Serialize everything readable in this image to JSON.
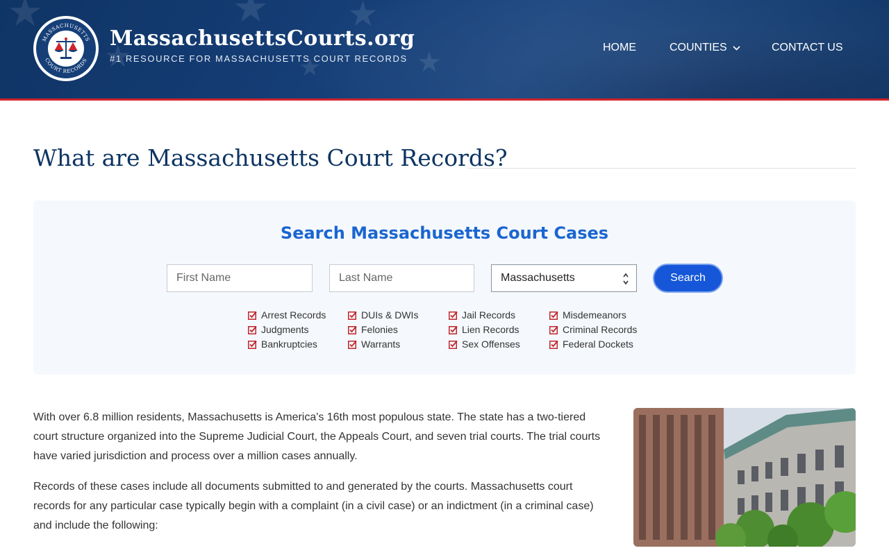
{
  "header": {
    "brand_title": "MassachusettsCourts.org",
    "brand_tagline": "#1 RESOURCE FOR MASSACHUSETTS COURT RECORDS",
    "seal_top_text": "MASSACHUSETTS",
    "seal_bottom_text": "COURT RECORDS",
    "nav": {
      "home": "HOME",
      "counties": "COUNTIES",
      "contact": "CONTACT US"
    }
  },
  "page_title": "What are Massachusetts Court Records?",
  "search": {
    "title": "Search Massachusetts Court Cases",
    "first_name_placeholder": "First Name",
    "last_name_placeholder": "Last Name",
    "state_selected": "Massachusetts",
    "button_label": "Search",
    "record_types": [
      "Arrest Records",
      "Judgments",
      "Bankruptcies",
      "DUIs & DWIs",
      "Felonies",
      "Warrants",
      "Jail Records",
      "Lien Records",
      "Sex Offenses",
      "Misdemeanors",
      "Criminal Records",
      "Federal Dockets"
    ]
  },
  "body": {
    "paragraph_1": "With over 6.8 million residents, Massachusetts is America's 16th most populous state. The state has a two-tiered court structure organized into the Supreme Judicial Court, the Appeals Court, and seven trial courts. The trial courts have varied jurisdiction and process over a million cases annually.",
    "paragraph_2": "Records of these cases include all documents submitted to and generated by the courts. Massachusetts court records for any particular case typically begin with a complaint (in a civil case) or an indictment (in a criminal case) and include the following:"
  },
  "colors": {
    "header_blue": "#163f78",
    "accent_red": "#d2232a",
    "search_blue": "#1557d8",
    "title_navy": "#0d3462"
  },
  "icons": {
    "logo": "scales-of-justice-seal-icon",
    "nav_dropdown": "chevron-down-icon",
    "checkbox": "checked-box-icon",
    "select": "select-updown-caret-icon"
  }
}
